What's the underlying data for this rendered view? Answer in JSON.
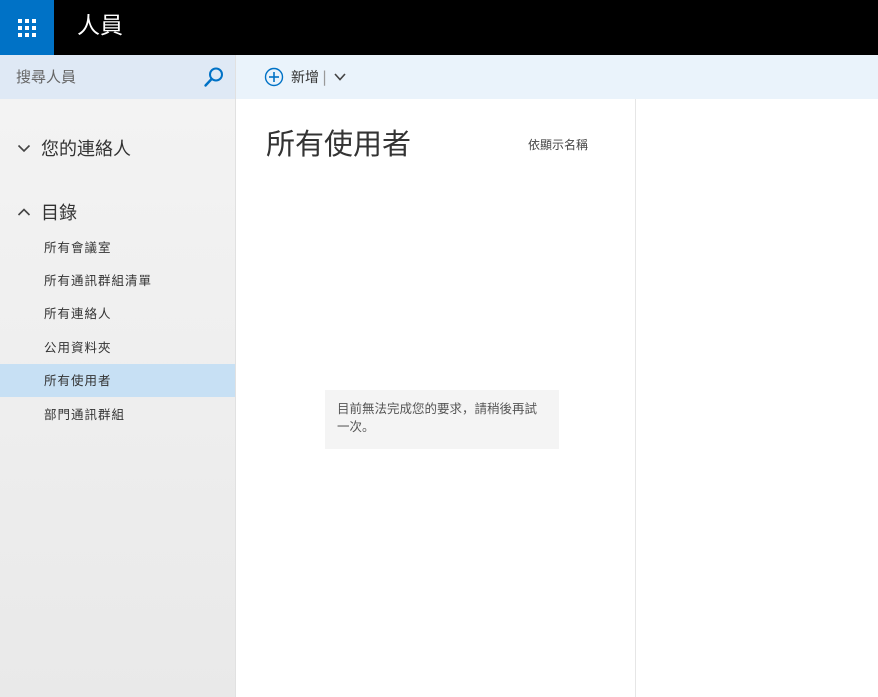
{
  "header": {
    "app_title": "人員"
  },
  "search": {
    "placeholder": "搜尋人員"
  },
  "sidebar": {
    "contacts_group": {
      "label": "您的連絡人",
      "expanded": false
    },
    "directory_group": {
      "label": "目錄",
      "expanded": true,
      "items": [
        {
          "label": "所有會議室"
        },
        {
          "label": "所有通訊群組清單"
        },
        {
          "label": "所有連絡人"
        },
        {
          "label": "公用資料夾"
        },
        {
          "label": "所有使用者",
          "selected": true
        },
        {
          "label": "部門通訊群組"
        }
      ]
    }
  },
  "toolbar": {
    "new_label": "新增",
    "separator": "|"
  },
  "list": {
    "title": "所有使用者",
    "sort_label": "依顯示名稱",
    "error_message": "目前無法完成您的要求，請稍後再試一次。"
  },
  "colors": {
    "accent": "#0072c6",
    "topbar": "#000000",
    "selected": "#c7e0f4",
    "cmdbar": "#eaf3fb"
  }
}
